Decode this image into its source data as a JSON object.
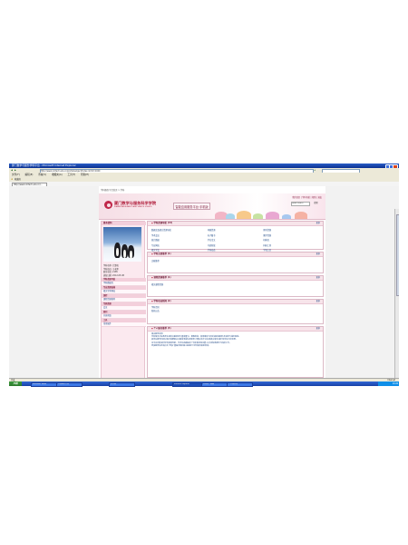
{
  "window": {
    "title": "厦门数学与服务学科平台 - Microsoft Internet Explorer",
    "address": "http://www.xmtech.edu.cn/portal/subject/Index.do?id=1020",
    "menu": [
      "文件(F)",
      "编辑(E)",
      "查看(V)",
      "收藏夹(A)",
      "工具(T)",
      "帮助(H)"
    ],
    "fav_label": "收藏夹",
    "tab_label": "http://www.xmtech.edu.cn/...",
    "status_left": "完成",
    "status_right": "Internet",
    "taskbar": {
      "start": "开始",
      "tasks": [
        "Microsoft Word",
        "学科服务平台",
        "文件夹",
        "Internet Explorer",
        "未命名 - 画图",
        "个人知识库"
      ],
      "clock": "10:26"
    }
  },
  "page": {
    "breadcrumb": "学科服务平台首页 > 学科",
    "logo_title": "厦门数学与服务科学学院",
    "logo_sub": "XIAMEN MATHEMATICS AND SERVICE SCIENCE",
    "site_name": "智能应用服务平台·手机版",
    "top_links": "我的首页 | 学科导航 | 帮助 | 退出",
    "search_placeholder": "请输入关键词",
    "search_button": "搜索"
  },
  "sidebar": {
    "head": "基本资料",
    "info": [
      "学科名称: 计算机",
      "学科馆员: 王老师",
      "联系电话: 2185",
      "更新日期: 2012-05-08"
    ],
    "sections": [
      {
        "title": "学科资源导航",
        "items": [
          "学科数据库"
        ]
      },
      {
        "title": "专业资源链接",
        "items": [
          "相关学术网站"
        ]
      },
      {
        "title": "课程",
        "items": [
          "课程资源推荐"
        ]
      },
      {
        "title": "专题资源",
        "items": [
          "会议"
        ]
      },
      {
        "title": "期刊",
        "items": [
          "开放获取"
        ]
      },
      {
        "title": "工具",
        "items": [
          "常用软件"
        ]
      }
    ]
  },
  "panels": {
    "more_label": "更多",
    "p1": {
      "title": "学科资源导航 (33)",
      "items": [
        "数据库及相关资源导航",
        "网络资源",
        "期刊资源",
        "学术会议",
        "电子图书",
        "教学资源",
        "统计数据",
        "学位论文",
        "机构库",
        "专业网站",
        "开放获取",
        "科研工具",
        "相关学会",
        "学科动态",
        "学者主页"
      ]
    },
    "p2": {
      "title": "学科文献推荐 (1)",
      "items": [
        "文献推荐"
      ]
    },
    "p3": {
      "title": "课程资源推荐 (1)",
      "items": [
        "相关课程资源"
      ]
    },
    "p4": {
      "title": "学科动态新闻 (2)",
      "items": [
        "学科资讯",
        "新闻公告"
      ]
    },
    "p5": {
      "title": "个人服务推荐 (3)",
      "items": [
        "相关服务说明",
        "学科馆员为院系师生提供文献检索与查收查引、课题咨询、资源推荐与培训讲座等服务,欢迎您与我们联系。",
        "如您在教学科研过程中需要相关文献资源或信息服务,可通过本平台在线提交需求,我们将尽快为您处理。",
        "本平台同时提供学科资源导航、学术动态跟踪及个性化推送等功能,以支持院系教学与科研工作。",
        "更多服务信息请点击“更多”查看详细内容,或直接与学科馆员联系咨询。"
      ]
    }
  }
}
